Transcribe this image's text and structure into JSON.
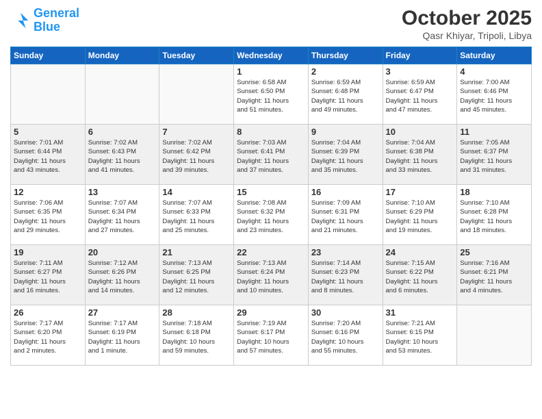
{
  "logo": {
    "line1": "General",
    "line2": "Blue"
  },
  "title": "October 2025",
  "location": "Qasr Khiyar, Tripoli, Libya",
  "weekdays": [
    "Sunday",
    "Monday",
    "Tuesday",
    "Wednesday",
    "Thursday",
    "Friday",
    "Saturday"
  ],
  "weeks": [
    [
      {
        "day": "",
        "info": ""
      },
      {
        "day": "",
        "info": ""
      },
      {
        "day": "",
        "info": ""
      },
      {
        "day": "1",
        "info": "Sunrise: 6:58 AM\nSunset: 6:50 PM\nDaylight: 11 hours\nand 51 minutes."
      },
      {
        "day": "2",
        "info": "Sunrise: 6:59 AM\nSunset: 6:48 PM\nDaylight: 11 hours\nand 49 minutes."
      },
      {
        "day": "3",
        "info": "Sunrise: 6:59 AM\nSunset: 6:47 PM\nDaylight: 11 hours\nand 47 minutes."
      },
      {
        "day": "4",
        "info": "Sunrise: 7:00 AM\nSunset: 6:46 PM\nDaylight: 11 hours\nand 45 minutes."
      }
    ],
    [
      {
        "day": "5",
        "info": "Sunrise: 7:01 AM\nSunset: 6:44 PM\nDaylight: 11 hours\nand 43 minutes."
      },
      {
        "day": "6",
        "info": "Sunrise: 7:02 AM\nSunset: 6:43 PM\nDaylight: 11 hours\nand 41 minutes."
      },
      {
        "day": "7",
        "info": "Sunrise: 7:02 AM\nSunset: 6:42 PM\nDaylight: 11 hours\nand 39 minutes."
      },
      {
        "day": "8",
        "info": "Sunrise: 7:03 AM\nSunset: 6:41 PM\nDaylight: 11 hours\nand 37 minutes."
      },
      {
        "day": "9",
        "info": "Sunrise: 7:04 AM\nSunset: 6:39 PM\nDaylight: 11 hours\nand 35 minutes."
      },
      {
        "day": "10",
        "info": "Sunrise: 7:04 AM\nSunset: 6:38 PM\nDaylight: 11 hours\nand 33 minutes."
      },
      {
        "day": "11",
        "info": "Sunrise: 7:05 AM\nSunset: 6:37 PM\nDaylight: 11 hours\nand 31 minutes."
      }
    ],
    [
      {
        "day": "12",
        "info": "Sunrise: 7:06 AM\nSunset: 6:35 PM\nDaylight: 11 hours\nand 29 minutes."
      },
      {
        "day": "13",
        "info": "Sunrise: 7:07 AM\nSunset: 6:34 PM\nDaylight: 11 hours\nand 27 minutes."
      },
      {
        "day": "14",
        "info": "Sunrise: 7:07 AM\nSunset: 6:33 PM\nDaylight: 11 hours\nand 25 minutes."
      },
      {
        "day": "15",
        "info": "Sunrise: 7:08 AM\nSunset: 6:32 PM\nDaylight: 11 hours\nand 23 minutes."
      },
      {
        "day": "16",
        "info": "Sunrise: 7:09 AM\nSunset: 6:31 PM\nDaylight: 11 hours\nand 21 minutes."
      },
      {
        "day": "17",
        "info": "Sunrise: 7:10 AM\nSunset: 6:29 PM\nDaylight: 11 hours\nand 19 minutes."
      },
      {
        "day": "18",
        "info": "Sunrise: 7:10 AM\nSunset: 6:28 PM\nDaylight: 11 hours\nand 18 minutes."
      }
    ],
    [
      {
        "day": "19",
        "info": "Sunrise: 7:11 AM\nSunset: 6:27 PM\nDaylight: 11 hours\nand 16 minutes."
      },
      {
        "day": "20",
        "info": "Sunrise: 7:12 AM\nSunset: 6:26 PM\nDaylight: 11 hours\nand 14 minutes."
      },
      {
        "day": "21",
        "info": "Sunrise: 7:13 AM\nSunset: 6:25 PM\nDaylight: 11 hours\nand 12 minutes."
      },
      {
        "day": "22",
        "info": "Sunrise: 7:13 AM\nSunset: 6:24 PM\nDaylight: 11 hours\nand 10 minutes."
      },
      {
        "day": "23",
        "info": "Sunrise: 7:14 AM\nSunset: 6:23 PM\nDaylight: 11 hours\nand 8 minutes."
      },
      {
        "day": "24",
        "info": "Sunrise: 7:15 AM\nSunset: 6:22 PM\nDaylight: 11 hours\nand 6 minutes."
      },
      {
        "day": "25",
        "info": "Sunrise: 7:16 AM\nSunset: 6:21 PM\nDaylight: 11 hours\nand 4 minutes."
      }
    ],
    [
      {
        "day": "26",
        "info": "Sunrise: 7:17 AM\nSunset: 6:20 PM\nDaylight: 11 hours\nand 2 minutes."
      },
      {
        "day": "27",
        "info": "Sunrise: 7:17 AM\nSunset: 6:19 PM\nDaylight: 11 hours\nand 1 minute."
      },
      {
        "day": "28",
        "info": "Sunrise: 7:18 AM\nSunset: 6:18 PM\nDaylight: 10 hours\nand 59 minutes."
      },
      {
        "day": "29",
        "info": "Sunrise: 7:19 AM\nSunset: 6:17 PM\nDaylight: 10 hours\nand 57 minutes."
      },
      {
        "day": "30",
        "info": "Sunrise: 7:20 AM\nSunset: 6:16 PM\nDaylight: 10 hours\nand 55 minutes."
      },
      {
        "day": "31",
        "info": "Sunrise: 7:21 AM\nSunset: 6:15 PM\nDaylight: 10 hours\nand 53 minutes."
      },
      {
        "day": "",
        "info": ""
      }
    ]
  ]
}
